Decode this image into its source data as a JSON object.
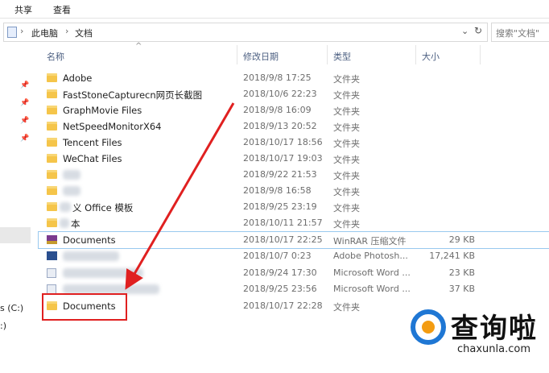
{
  "ribbon": {
    "tabs": [
      "共享",
      "查看"
    ]
  },
  "address": {
    "crumbs": [
      "此电脑",
      "文档"
    ],
    "search_placeholder": "搜索\"文档\""
  },
  "nav": {
    "drive_label": "s (C:)",
    "other_label": ":)"
  },
  "columns": {
    "name": "名称",
    "date": "修改日期",
    "type": "类型",
    "size": "大小"
  },
  "files": [
    {
      "name": "Adobe",
      "date": "2018/9/8 17:25",
      "type": "文件夹",
      "size": "",
      "icon": "folder-icon"
    },
    {
      "name": "FastStoneCapturecn网页长截图",
      "date": "2018/10/6 22:23",
      "type": "文件夹",
      "size": "",
      "icon": "folder-icon"
    },
    {
      "name": "GraphMovie Files",
      "date": "2018/9/8 16:09",
      "type": "文件夹",
      "size": "",
      "icon": "folder-icon"
    },
    {
      "name": "NetSpeedMonitorX64",
      "date": "2018/9/13 20:52",
      "type": "文件夹",
      "size": "",
      "icon": "folder-icon"
    },
    {
      "name": "Tencent Files",
      "date": "2018/10/17 18:56",
      "type": "文件夹",
      "size": "",
      "icon": "folder-icon"
    },
    {
      "name": "WeChat Files",
      "date": "2018/10/17 19:03",
      "type": "文件夹",
      "size": "",
      "icon": "folder-icon"
    },
    {
      "name": "",
      "date": "2018/9/22 21:53",
      "type": "文件夹",
      "size": "",
      "icon": "folder-icon"
    },
    {
      "name": "",
      "date": "2018/9/8 16:58",
      "type": "文件夹",
      "size": "",
      "icon": "folder-icon"
    },
    {
      "name": "义 Office 模板",
      "date": "2018/9/25 23:19",
      "type": "文件夹",
      "size": "",
      "icon": "folder-icon"
    },
    {
      "name": "本",
      "date": "2018/10/11 21:57",
      "type": "文件夹",
      "size": "",
      "icon": "folder-icon"
    },
    {
      "name": "Documents",
      "date": "2018/10/17 22:25",
      "type": "WinRAR 压缩文件",
      "size": "29 KB",
      "icon": "winrar-archive-icon"
    },
    {
      "name": "",
      "date": "2018/10/7 0:23",
      "type": "Adobe Photosh...",
      "size": "17,241 KB",
      "icon": "photoshop-file-icon"
    },
    {
      "name": "",
      "date": "2018/9/24 17:30",
      "type": "Microsoft Word ...",
      "size": "23 KB",
      "icon": "word-document-icon"
    },
    {
      "name": "",
      "date": "2018/9/25 23:56",
      "type": "Microsoft Word ...",
      "size": "37 KB",
      "icon": "word-document-icon"
    },
    {
      "name": "Documents",
      "date": "2018/10/17 22:28",
      "type": "文件夹",
      "size": "",
      "icon": "folder-icon"
    }
  ],
  "watermark": {
    "brand": "查询啦",
    "url": "chaxunla.com"
  },
  "colors": {
    "annotation": "#e02020",
    "folder": "#f5c54a",
    "header_text": "#4d6082"
  }
}
